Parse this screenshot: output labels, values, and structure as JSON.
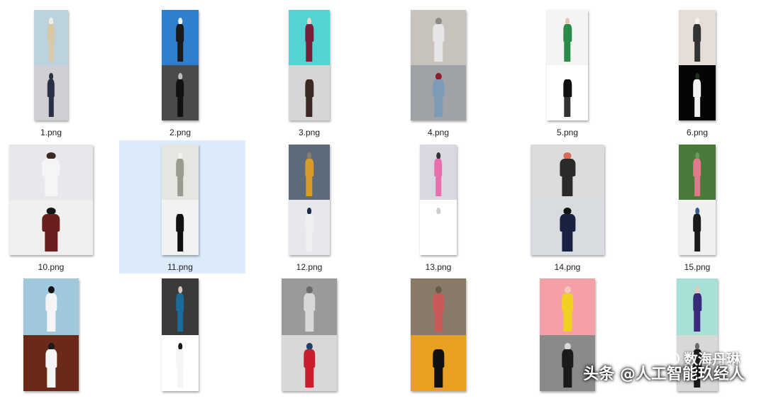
{
  "files": [
    {
      "name": "1.png",
      "top": [
        "#bcd3de",
        "#d9c8a6",
        "#f2eee5"
      ],
      "bottom": [
        "#cfcfd3",
        "#2a2f44",
        "#2a2f44"
      ]
    },
    {
      "name": "2.png",
      "top": [
        "#2f7fd0",
        "#1a1a1a",
        "#e9f0f7"
      ],
      "bottom": [
        "#4a4a4a",
        "#111111",
        "#bdbdbd"
      ]
    },
    {
      "name": "3.png",
      "top": [
        "#54d3d4",
        "#7a1f3a",
        "#f0d5c8"
      ],
      "bottom": [
        "#d6d6d6",
        "#3a2a22",
        "#d6d6d6"
      ]
    },
    {
      "name": "4.png",
      "top": [
        "#c8c2bc",
        "#e6e6e6",
        "#8f8a85"
      ],
      "bottom": [
        "#9fa3a8",
        "#7b9bb7",
        "#8e1c2c"
      ]
    },
    {
      "name": "5.png",
      "top": [
        "#f4f4f4",
        "#2a8a4a",
        "#e7c7b0"
      ],
      "bottom": [
        "#ffffff",
        "#111111",
        "#ffffff"
      ]
    },
    {
      "name": "6.png",
      "top": [
        "#e5ddd6",
        "#333333",
        "#f6f2ef"
      ],
      "bottom": [
        "#050505",
        "#f2f2f2",
        "#1e3020"
      ]
    },
    {
      "name": "10.png",
      "top": [
        "#e8e8ec",
        "#f5f5f5",
        "#3a2a22"
      ],
      "bottom": [
        "#efefef",
        "#6a1e1e",
        "#151515"
      ]
    },
    {
      "name": "11.png",
      "top": [
        "#e6e6e0",
        "#9b9b8f",
        "#f2f2ee"
      ],
      "bottom": [
        "#f2f2f2",
        "#111111",
        "#f2f2f2"
      ]
    },
    {
      "name": "12.png",
      "top": [
        "#5c6a7a",
        "#d89a2a",
        "#8b7e6a"
      ],
      "bottom": [
        "#e8e8ec",
        "#f0f0f0",
        "#1a2a4a"
      ]
    },
    {
      "name": "13.png",
      "top": [
        "#d8d8e0",
        "#e86fae",
        "#333333"
      ],
      "bottom": [
        "#ffffff",
        "#ffffff",
        "#cccccc"
      ]
    },
    {
      "name": "14.png",
      "top": [
        "#dcdcdc",
        "#2a2a2a",
        "#d86a5a"
      ],
      "bottom": [
        "#d8dbe0",
        "#1a2040",
        "#111111"
      ]
    },
    {
      "name": "15.png",
      "top": [
        "#4a7a3a",
        "#e07a8a",
        "#6a9a5a"
      ],
      "bottom": [
        "#f0f0f0",
        "#1a1a1a",
        "#3a5a8a"
      ]
    },
    {
      "name": "",
      "top": [
        "#9fc7dd",
        "#f5f5f5",
        "#111111"
      ],
      "bottom": [
        "#6a2a1a",
        "#f5f5f5",
        "#1a1a1a"
      ]
    },
    {
      "name": "",
      "top": [
        "#3a3a3a",
        "#1a6a9a",
        "#d8c8b8"
      ],
      "bottom": [
        "#ffffff",
        "#f5f5f5",
        "#1a1a1a"
      ]
    },
    {
      "name": "",
      "top": [
        "#9a9a9a",
        "#d8d8d8",
        "#6a6a6a"
      ],
      "bottom": [
        "#d8d8d8",
        "#c81e2e",
        "#2a3a6a"
      ]
    },
    {
      "name": "",
      "top": [
        "#8a7a6a",
        "#c85a5a",
        "#6a5a4a"
      ],
      "bottom": [
        "#e8a020",
        "#111111",
        "#e8a020"
      ]
    },
    {
      "name": "",
      "top": [
        "#f5a0a8",
        "#f0d020",
        "#f2c8b8"
      ],
      "bottom": [
        "#8a8a8a",
        "#1a1a1a",
        "#d8d8d8"
      ]
    },
    {
      "name": "",
      "top": [
        "#a8e0d8",
        "#3a2a7a",
        "#e8c8b8"
      ],
      "bottom": [
        "#d8d8d8",
        "#1a1a1a",
        "#6a6a6a"
      ]
    }
  ],
  "watermark": {
    "line1": "数海丹琳",
    "line2": "头条 @人工智能玖经人"
  }
}
